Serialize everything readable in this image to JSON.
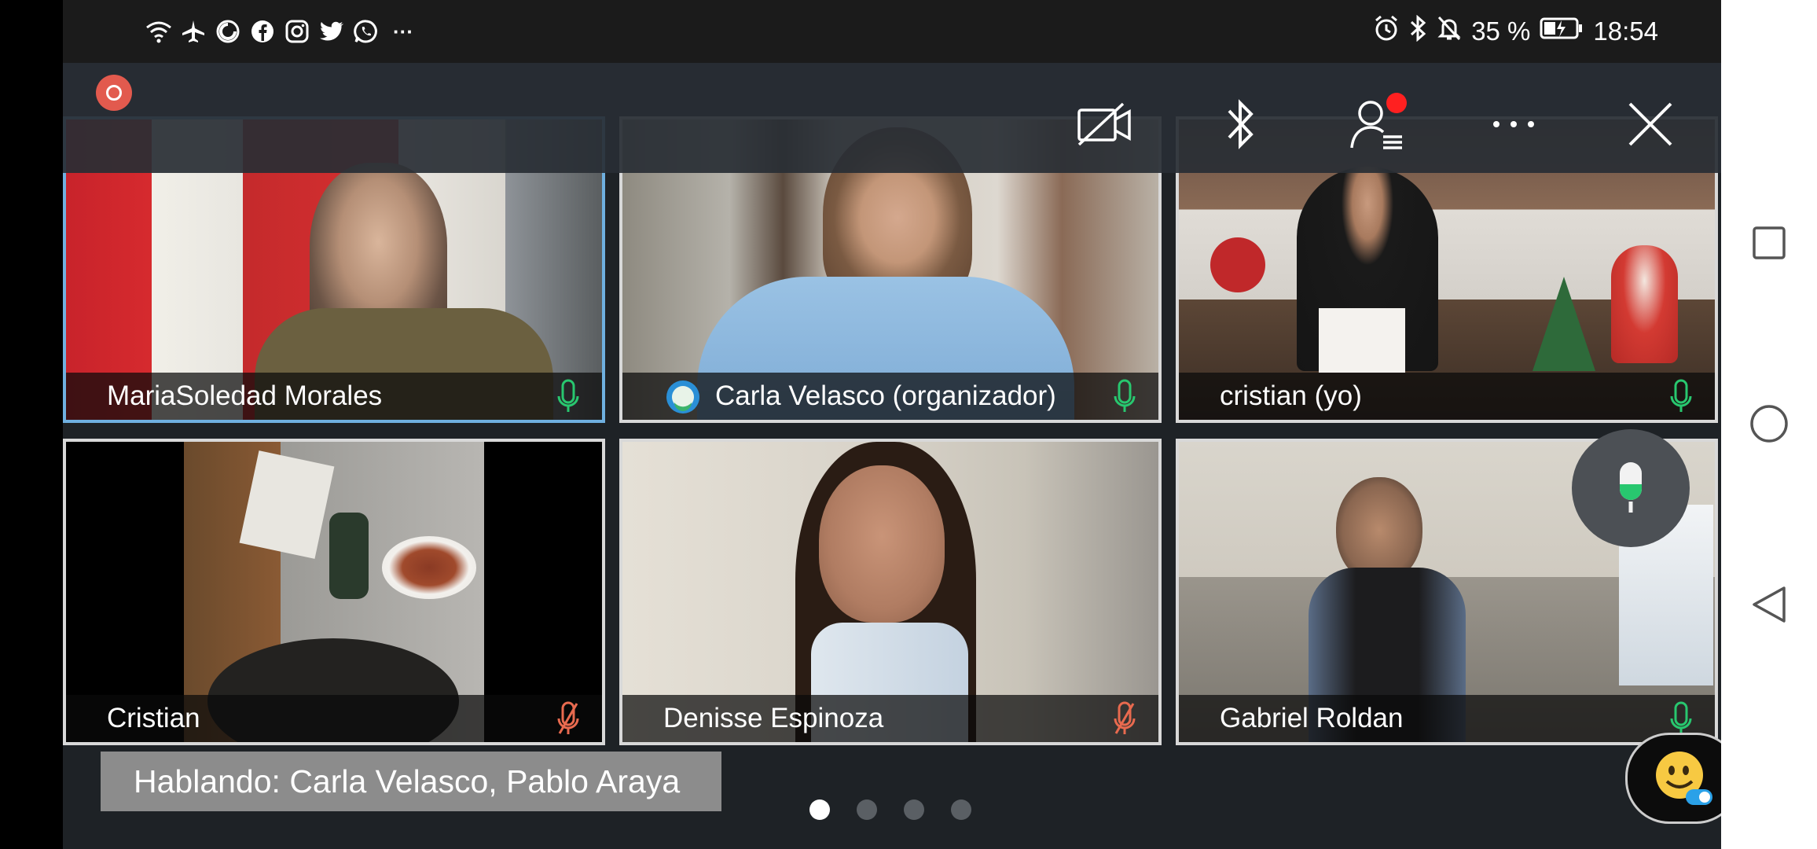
{
  "status_bar": {
    "left_icons": [
      "wifi-icon",
      "airplane-icon",
      "sync-icon",
      "facebook-icon",
      "instagram-icon",
      "twitter-icon",
      "whatsapp-icon",
      "more-icon"
    ],
    "more_label": "···",
    "battery_text": "35 %",
    "time": "18:54"
  },
  "toolbar": {
    "icons": [
      "camera-off-icon",
      "bluetooth-icon",
      "participants-icon",
      "more-options-icon",
      "close-icon"
    ]
  },
  "participants": [
    {
      "name": "MariaSoledad Morales",
      "mic": "on",
      "active": true
    },
    {
      "name": "Carla Velasco (organizador)",
      "mic": "on",
      "organizer_badge": true
    },
    {
      "name": "cristian (yo)",
      "mic": "on"
    },
    {
      "name": "Cristian",
      "mic": "muted"
    },
    {
      "name": "Denisse Espinoza",
      "mic": "muted"
    },
    {
      "name": "Gabriel Roldan",
      "mic": "on"
    }
  ],
  "speaking_label": "Hablando: Carla Velasco, Pablo Araya",
  "pager": {
    "pages": 4,
    "current": 1
  },
  "colors": {
    "background": "#1e2226",
    "mic_on": "#28c76f",
    "mic_muted": "#e86a4f",
    "active_border": "#6fb0e0",
    "notification": "#ff2020"
  }
}
